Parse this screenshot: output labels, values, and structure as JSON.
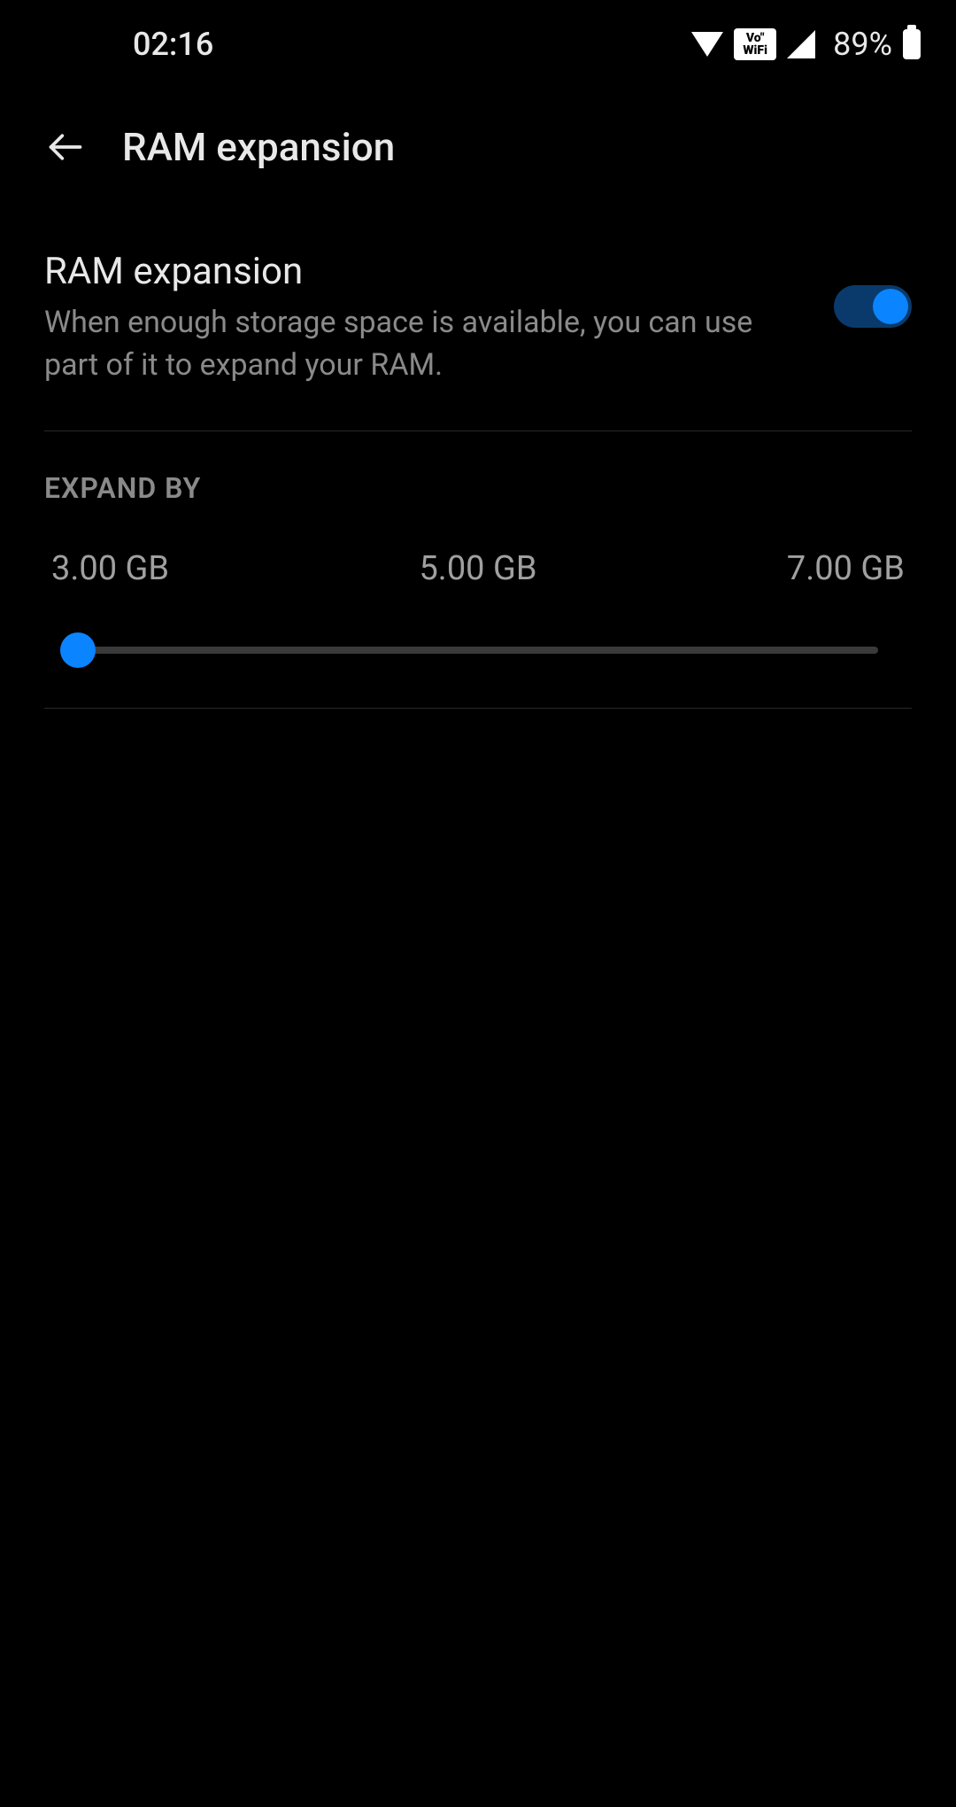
{
  "status_bar": {
    "time": "02:16",
    "battery": "89%",
    "vowifi_top": "Vo\"",
    "vowifi_bottom": "WiFi"
  },
  "header": {
    "title": "RAM expansion"
  },
  "setting": {
    "title": "RAM expansion",
    "description": "When enough storage space is available, you can use part of it to expand your RAM.",
    "toggle_on": true
  },
  "expand": {
    "header": "EXPAND BY",
    "options": [
      "3.00 GB",
      "5.00 GB",
      "7.00 GB"
    ],
    "selected_index": 0
  }
}
